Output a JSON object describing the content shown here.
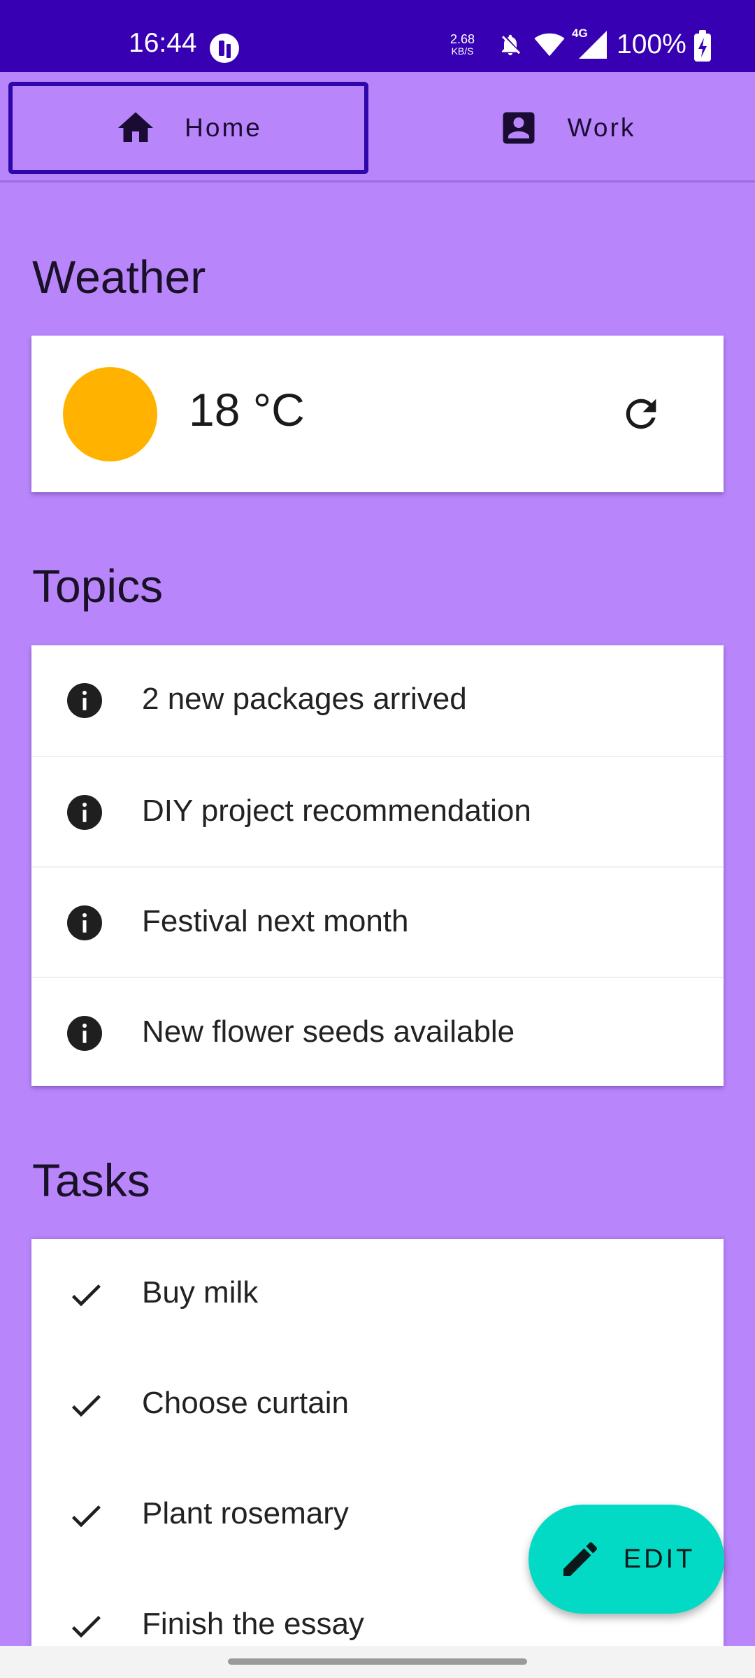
{
  "status_bar": {
    "time": "16:44",
    "net_speed_value": "2.68",
    "net_speed_unit": "KB/S",
    "signal_label": "4G",
    "battery_percent": "100%",
    "icons": [
      "app-badge-icon",
      "bell-off-icon",
      "wifi-icon",
      "cell-signal-icon",
      "battery-charging-icon"
    ]
  },
  "tabs": [
    {
      "label": "Home",
      "icon": "home-icon",
      "selected": true
    },
    {
      "label": "Work",
      "icon": "contact-card-icon",
      "selected": false
    }
  ],
  "weather": {
    "title": "Weather",
    "temperature": "18 °C",
    "icon": "sun-icon",
    "sun_color": "#ffb300"
  },
  "topics": {
    "title": "Topics",
    "items": [
      {
        "text": "2 new packages arrived",
        "icon": "info-icon"
      },
      {
        "text": "DIY project recommendation",
        "icon": "info-icon"
      },
      {
        "text": "Festival next month",
        "icon": "info-icon"
      },
      {
        "text": "New flower seeds available",
        "icon": "info-icon"
      }
    ]
  },
  "tasks": {
    "title": "Tasks",
    "items": [
      {
        "text": "Buy milk",
        "icon": "check-icon"
      },
      {
        "text": "Choose curtain",
        "icon": "check-icon"
      },
      {
        "text": "Plant rosemary",
        "icon": "check-icon"
      },
      {
        "text": "Finish the essay",
        "icon": "check-icon"
      }
    ]
  },
  "fab": {
    "label": "EDIT",
    "icon": "pencil-icon",
    "color": "#03dac5"
  },
  "colors": {
    "status_bar": "#3700b3",
    "background": "#b886fa",
    "selected_tab_border": "#2e06a9"
  }
}
